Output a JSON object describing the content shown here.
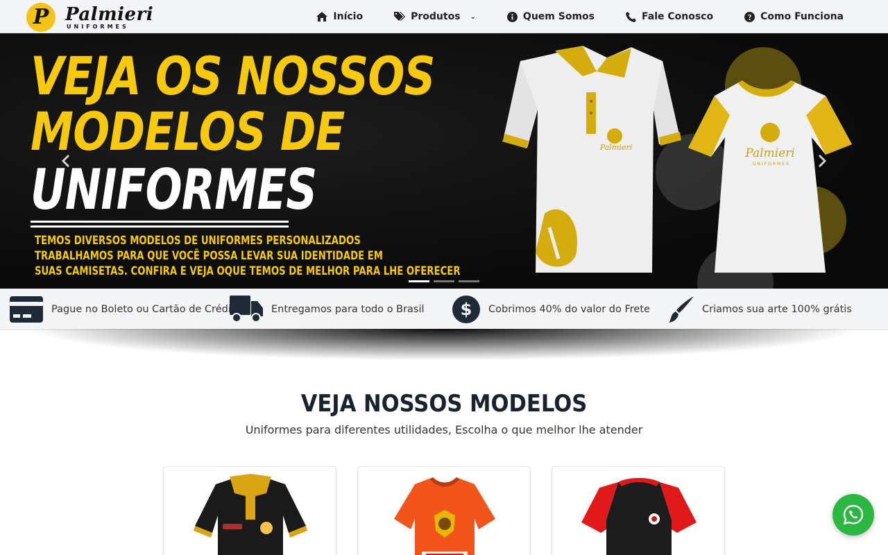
{
  "brand": {
    "logo_letter": "P",
    "name": "Palmieri",
    "tagline": "UNIFORMES",
    "accent_color": "#f3c317"
  },
  "nav": {
    "items": [
      {
        "label": "Início",
        "icon": "home-icon"
      },
      {
        "label": "Produtos",
        "icon": "tags-icon",
        "has_dropdown": true
      },
      {
        "label": "Quem Somos",
        "icon": "info-circle-icon"
      },
      {
        "label": "Fale Conosco",
        "icon": "phone-icon"
      },
      {
        "label": "Como Funciona",
        "icon": "question-circle-icon"
      }
    ]
  },
  "hero": {
    "line1": "VEJA OS NOSSOS",
    "line2": "MODELOS DE",
    "line3": "UNIFORMES",
    "desc1": "TEMOS DIVERSOS MODELOS DE UNIFORMES PERSONALIZADOS",
    "desc2": "TRABALHAMOS PARA QUE VOCÊ POSSA LEVAR SUA IDENTIDADE EM",
    "desc3": "SUAS CAMISETAS. CONFIRA E VEJA OQUE TEMOS DE MELHOR PARA LHE OFERECER",
    "shirt_brand": "Palmieri",
    "shirt_brand_sub": "UNIFORMES",
    "slides_total": 3,
    "active_slide": 1,
    "title_color": "#f6c90e"
  },
  "features": [
    {
      "label": "Pague no Boleto ou Cartão de Crédito",
      "icon": "credit-card-icon"
    },
    {
      "label": "Entregamos para todo o Brasil",
      "icon": "truck-icon"
    },
    {
      "label": "Cobrimos 40% do valor do Frete",
      "icon": "dollar-circle-icon"
    },
    {
      "label": "Criamos sua arte 100% grátis",
      "icon": "paint-brush-icon"
    }
  ],
  "models": {
    "title": "VEJA NOSSOS MODELOS",
    "subtitle": "Uniformes para diferentes utilidades, Escolha o que melhor lhe atender",
    "cards": [
      {
        "name": "black-polo",
        "colors": [
          "#1a1a1a",
          "#d9a514"
        ]
      },
      {
        "name": "orange-jersey",
        "colors": [
          "#f2541b",
          "#e6b800"
        ]
      },
      {
        "name": "red-black-raglan",
        "colors": [
          "#1c1c1c",
          "#e01a1a"
        ]
      }
    ]
  },
  "whatsapp": {
    "icon": "whatsapp-icon",
    "color": "#2cb742"
  }
}
